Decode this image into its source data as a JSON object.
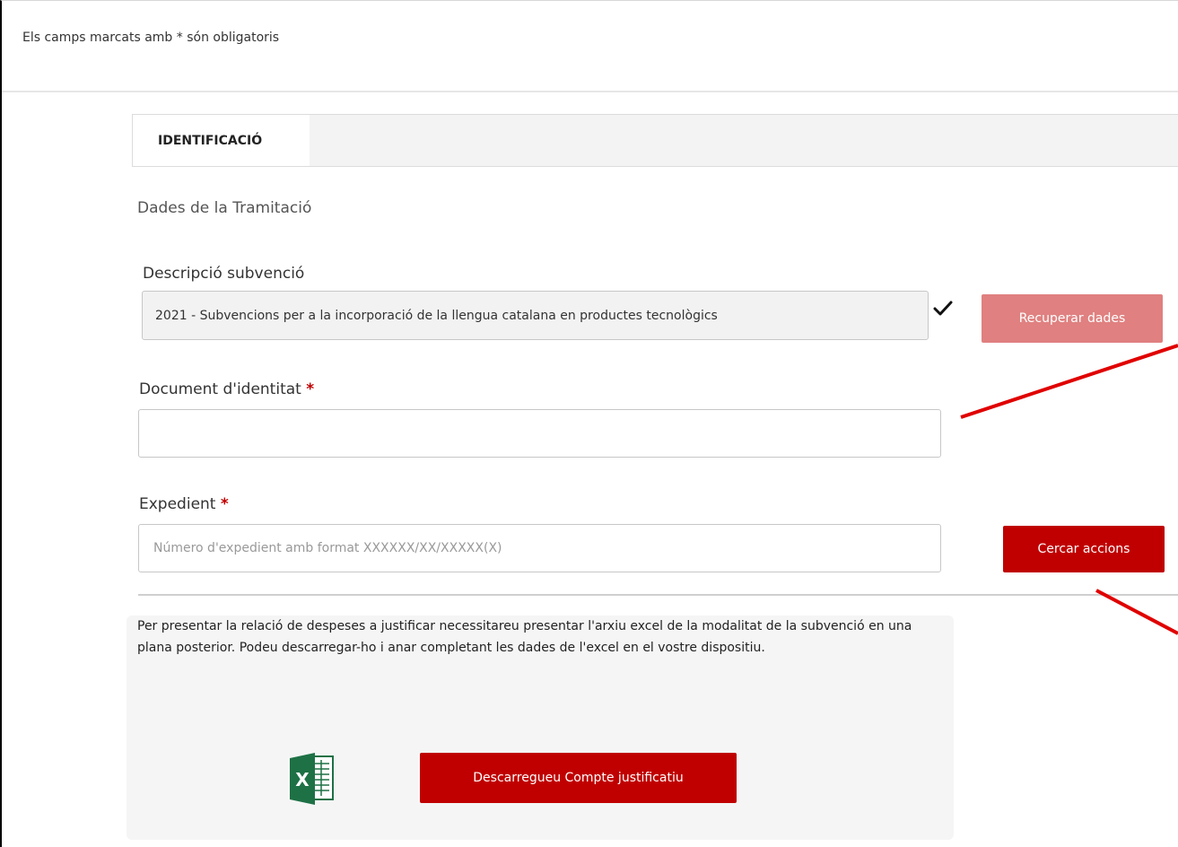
{
  "form": {
    "required_note": "Els camps marcats amb * són obligatoris",
    "tab_label": "IDENTIFICACIÓ",
    "section_title": "Dades de la Tramitació",
    "subvention": {
      "label": "Descripció subvenció",
      "value": "2021 - Subvencions per a la incorporació de la llengua catalana en productes tecnològics",
      "recover_button": "Recuperar dades"
    },
    "identity": {
      "label": "Document d'identitat",
      "required_mark": "*",
      "value": ""
    },
    "expedient": {
      "label": "Expedient",
      "required_mark": "*",
      "placeholder": "Número d'expedient amb format XXXXXX/XX/XXXXX(X)",
      "search_button": "Cercar accions"
    },
    "info": {
      "text": "Per presentar la relació de despeses a justificar necessitareu presentar l'arxiu excel de la modalitat de la subvenció en una plana posterior. Podeu descarregar-ho i anar completant les dades de l'excel en el vostre dispositiu.",
      "download_button": "Descarregueu Compte justificatiu",
      "excel_icon_letter": "X"
    }
  },
  "colors": {
    "primary": "#c00000",
    "disabled": "#e08080",
    "excel_green": "#1e7145",
    "annotation": "#e00000"
  }
}
